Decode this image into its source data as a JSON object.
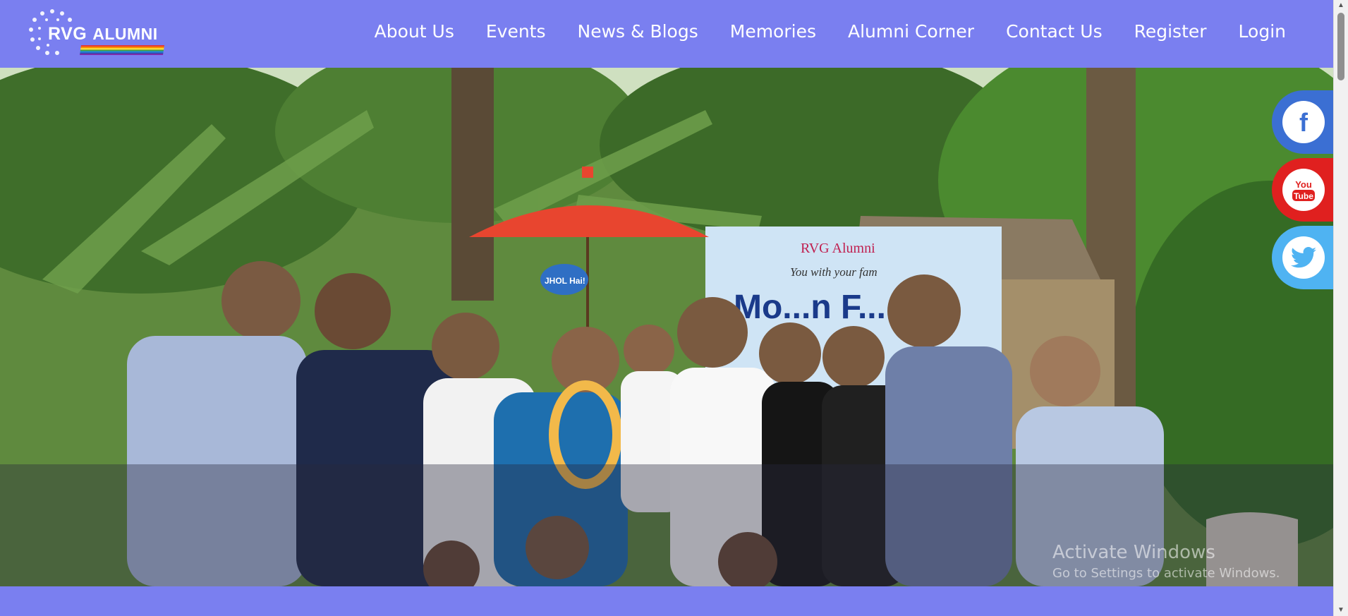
{
  "brand": {
    "logo_primary": "RVG",
    "logo_secondary": "ALUMNI",
    "header_color": "#7a7ff0"
  },
  "nav": {
    "items": [
      {
        "label": "About Us"
      },
      {
        "label": "Events"
      },
      {
        "label": "News & Blogs"
      },
      {
        "label": "Memories"
      },
      {
        "label": "Alumni Corner"
      },
      {
        "label": "Contact Us"
      },
      {
        "label": "Register"
      },
      {
        "label": "Login"
      }
    ]
  },
  "hero": {
    "banner_title": "RVG Alumni",
    "banner_subtitle": "You with your fam",
    "banner_headline": "Mo...n F...",
    "sign_text": "JHOL Hai!"
  },
  "social": {
    "facebook": {
      "icon": "facebook-icon",
      "label": "f",
      "color": "#3b6fd3"
    },
    "youtube": {
      "icon": "youtube-icon",
      "label_top": "You",
      "label_bottom": "Tube",
      "color": "#e0201f"
    },
    "twitter": {
      "icon": "twitter-icon",
      "color": "#4fb3f2"
    }
  },
  "watermark": {
    "line1": "Activate Windows",
    "line2": "Go to Settings to activate Windows."
  }
}
